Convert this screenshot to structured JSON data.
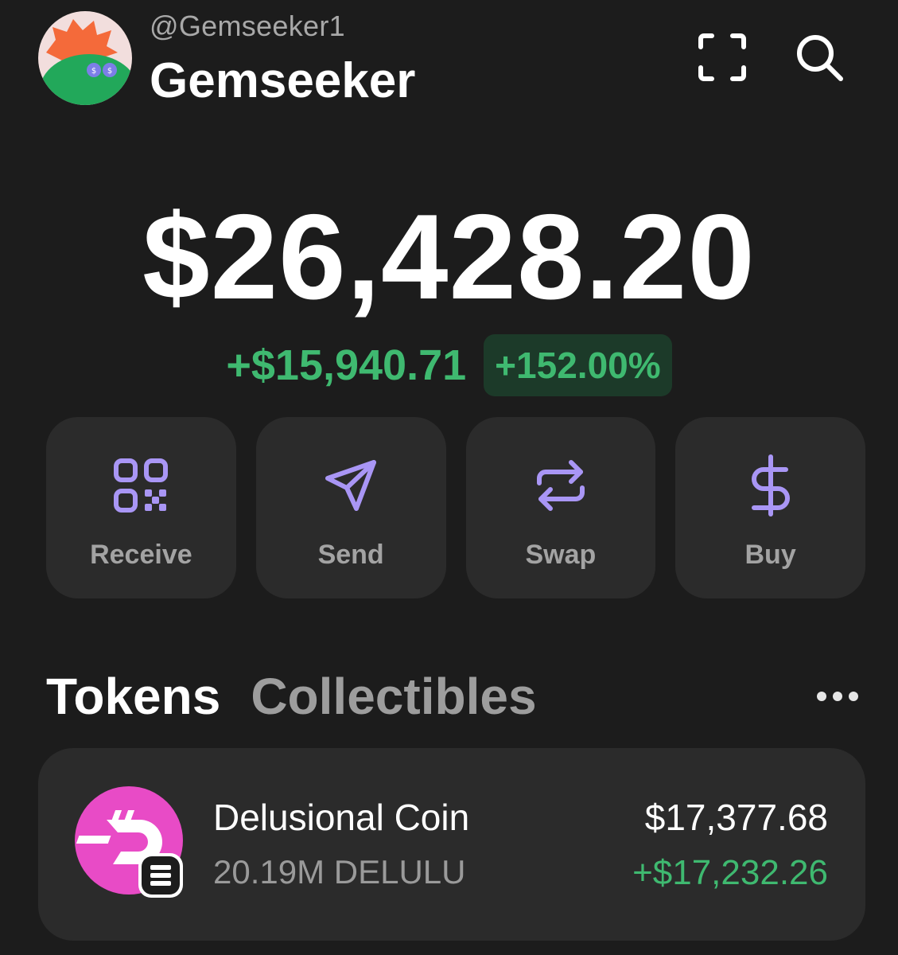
{
  "profile": {
    "handle": "@Gemseeker1",
    "name": "Gemseeker"
  },
  "header": {
    "scan_icon": "scan-icon",
    "search_icon": "search-icon"
  },
  "balance": {
    "total": "$26,428.20",
    "change_amount": "+$15,940.71",
    "change_percent": "+152.00%"
  },
  "actions": [
    {
      "label": "Receive",
      "icon": "qr-code-icon"
    },
    {
      "label": "Send",
      "icon": "send-icon"
    },
    {
      "label": "Swap",
      "icon": "swap-icon"
    },
    {
      "label": "Buy",
      "icon": "dollar-icon"
    }
  ],
  "tabs": {
    "tokens": "Tokens",
    "collectibles": "Collectibles"
  },
  "tokens": [
    {
      "name": "Delusional Coin",
      "amount": "20.19M DELULU",
      "value": "$17,377.68",
      "change": "+$17,232.26"
    }
  ],
  "colors": {
    "background": "#1c1c1c",
    "card": "#2b2b2b",
    "accent_purple": "#a996f5",
    "positive_green": "#3fb970",
    "token_pink": "#e84bc6"
  }
}
